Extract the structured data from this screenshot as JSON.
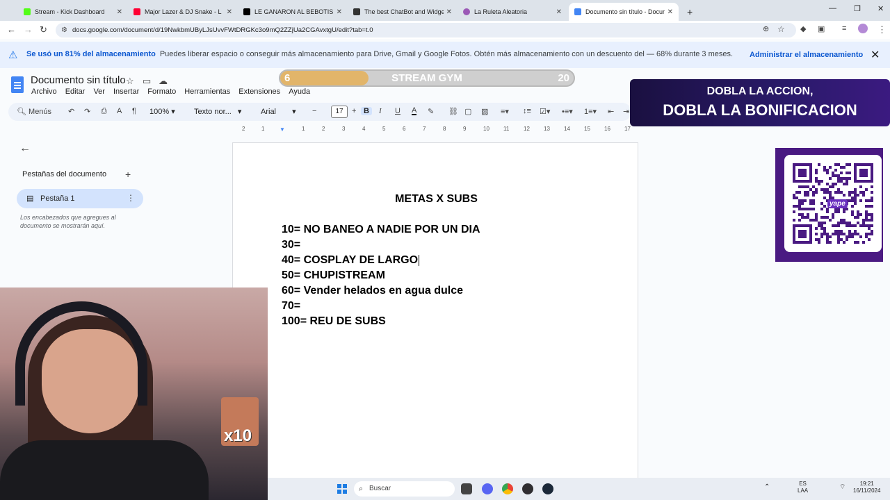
{
  "browser": {
    "tabs": [
      {
        "title": "Stream - Kick Dashboard",
        "favicon_color": "#53fc18",
        "active": false
      },
      {
        "title": "Major Lazer & DJ Snake - L",
        "favicon_color": "#ff0033",
        "active": false
      },
      {
        "title": "LE GANARON AL BEBOTISMO",
        "favicon_color": "#000000",
        "active": false
      },
      {
        "title": "The best ChatBot and Widgets",
        "favicon_color": "#333333",
        "active": false
      },
      {
        "title": "La Ruleta Aleatoria",
        "favicon_color": "#9b59b6",
        "active": false
      },
      {
        "title": "Documento sin título - Docum",
        "favicon_color": "#4285f4",
        "active": true
      }
    ],
    "new_tab": "+",
    "url": "docs.google.com/document/d/19NwkbmUByLJsUvvFWtDRGKc3o9mQ2ZZjUa2CGAvxtgU/edit?tab=t.0"
  },
  "banner": {
    "bold_text": "Se usó un 81% del almacenamiento",
    "text": "Puedes liberar espacio o conseguir más almacenamiento para Drive, Gmail y Google Fotos. Obtén más almacenamiento con un descuento del — 68% durante 3 meses.",
    "action": "Administrar el almacenamiento",
    "close": "✕"
  },
  "docs": {
    "title": "Documento sin título",
    "menu": [
      "Archivo",
      "Editar",
      "Ver",
      "Insertar",
      "Formato",
      "Herramientas",
      "Extensiones",
      "Ayuda"
    ],
    "toolbar": {
      "search": "Menús",
      "zoom": "100%",
      "style": "Texto nor...",
      "font": "Arial",
      "font_size": "17",
      "bold": "B",
      "italic": "I",
      "underline": "U"
    },
    "ruler_ticks": [
      "2",
      "1",
      "1",
      "2",
      "3",
      "4",
      "5",
      "6",
      "7",
      "8",
      "9",
      "10",
      "11",
      "12",
      "13",
      "14",
      "15",
      "16",
      "17",
      "18"
    ]
  },
  "sidebar": {
    "heading": "Pestañas del documento",
    "add": "+",
    "tab_label": "Pestaña 1",
    "hint": "Los encabezados que agregues al documento se mostrarán aquí."
  },
  "document": {
    "heading": "METAS X SUBS",
    "goals": [
      "10= NO BANEO A NADIE POR UN DIA",
      "30=",
      "40= COSPLAY DE LARGO",
      "50= CHUPISTREAM",
      "60= Vender helados en agua dulce",
      "70=",
      "100= REU DE SUBS"
    ]
  },
  "overlays": {
    "gym": {
      "left": "6",
      "center": "STREAM GYM",
      "right": "20",
      "progress": 0.3
    },
    "promo": {
      "line1": "DOBLA LA ACCION,",
      "line2": "DOBLA LA BONIFICACION"
    },
    "qr_label": "yape",
    "emote_label": "x10"
  },
  "taskbar": {
    "search": "Buscar",
    "lang": "ES",
    "lang2": "LAA",
    "time": "19:21",
    "date": "16/11/2024"
  }
}
